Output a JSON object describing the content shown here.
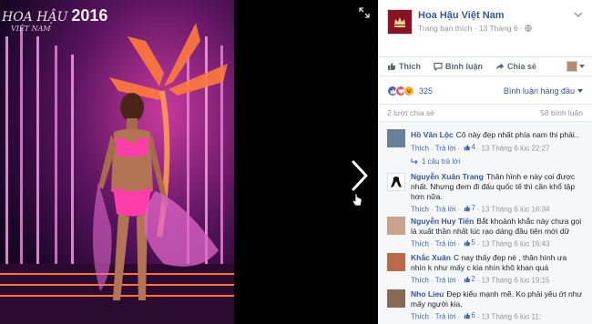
{
  "photo": {
    "logo_text": "HOA HẬU",
    "logo_year": "2016",
    "logo_sub": "VIỆT NAM"
  },
  "post": {
    "page_name": "Hoa Hậu Việt Nam",
    "meta_source": "Trang bạn thích",
    "meta_date": "13 Tháng 6",
    "actions": {
      "like": "Thích",
      "comment": "Bình luận",
      "share": "Chia sẻ"
    },
    "reaction_count": "325",
    "sort_label": "Bình luận hàng đầu",
    "shares_label": "2 lượt chia sẻ",
    "comments_label": "58 bình luận"
  },
  "comments": [
    {
      "author": "Hồ Văn Lộc",
      "text": "Cô này đẹp nhất phía nam thi phải..",
      "like": "Thích",
      "reply": "Trả lời",
      "likes": "4",
      "date": "13 Tháng 6 lúc 22:27",
      "replies": "1 câu trả lời",
      "avatar_color": "#6a7f9a"
    },
    {
      "author": "Nguyễn Xuân Trang",
      "text": "Thân hình e này coi được nhất. Nhưng đem đi đấu quốc tế thì cần khổ tập hơn nữa.",
      "like": "Thích",
      "reply": "Trả lời",
      "likes": "7",
      "date": "13 Tháng 6 lúc 16:34",
      "avatar_color": "#ffffff"
    },
    {
      "author": "Nguyễn Huy Tiến",
      "text": "Bắt khoảnh khắc này chưa gọi là xuất thần nhất lúc rạo dáng đầu tiên mới dữ",
      "like": "Thích",
      "reply": "Trả lời",
      "likes": "5",
      "date": "13 Tháng 6 lúc 16:43",
      "avatar_color": "#c9a48a"
    },
    {
      "author": "Khắc Xuân",
      "text": "C nay thấy đẹp nè , thân hình ưa nhìn k như mấy c kia nhìn khô khan quá",
      "like": "Thích",
      "reply": "Trả lời",
      "likes": "2",
      "date": "13 Tháng 6 lúc 19:15",
      "avatar_color": "#b86a4a"
    },
    {
      "author": "Nho Lieu",
      "text": "Đẹp kiểu mạnh mẽ. Ko phải yếu ớt như mấy người kia.",
      "like": "Thích",
      "reply": "Trả lời",
      "likes": "6",
      "date": "13 Tháng 6 lúc 11:",
      "avatar_color": "#8a6a55"
    }
  ],
  "colors": {
    "link": "#365899",
    "like_blue": "#4267b2",
    "love_red": "#f25268",
    "haha_yellow": "#f7b125"
  },
  "icons": [
    "expand-icon",
    "next-arrow-icon",
    "chevron-down-icon",
    "like-icon",
    "comment-icon",
    "share-icon",
    "reply-arrow-icon"
  ]
}
